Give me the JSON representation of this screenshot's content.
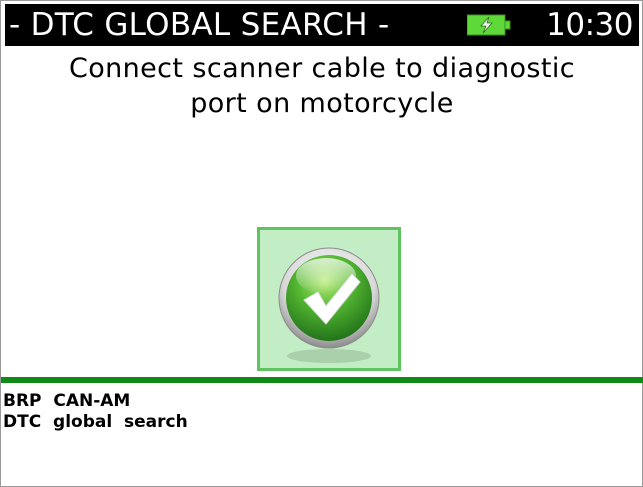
{
  "header": {
    "title": "- DTC GLOBAL SEARCH -",
    "clock": "10:30",
    "battery_icon": "battery-charging-icon",
    "battery_color": "#5fd83a"
  },
  "message": {
    "line1": "Connect scanner cable to diagnostic",
    "line2": "port on motorcycle"
  },
  "confirm": {
    "icon": "checkmark-icon",
    "accent": "#3fb43f"
  },
  "footer": {
    "line1": "BRP  CAN-AM",
    "line2": "DTC  global  search"
  },
  "colors": {
    "title_bg": "#000000",
    "divider": "#0f8a14"
  }
}
